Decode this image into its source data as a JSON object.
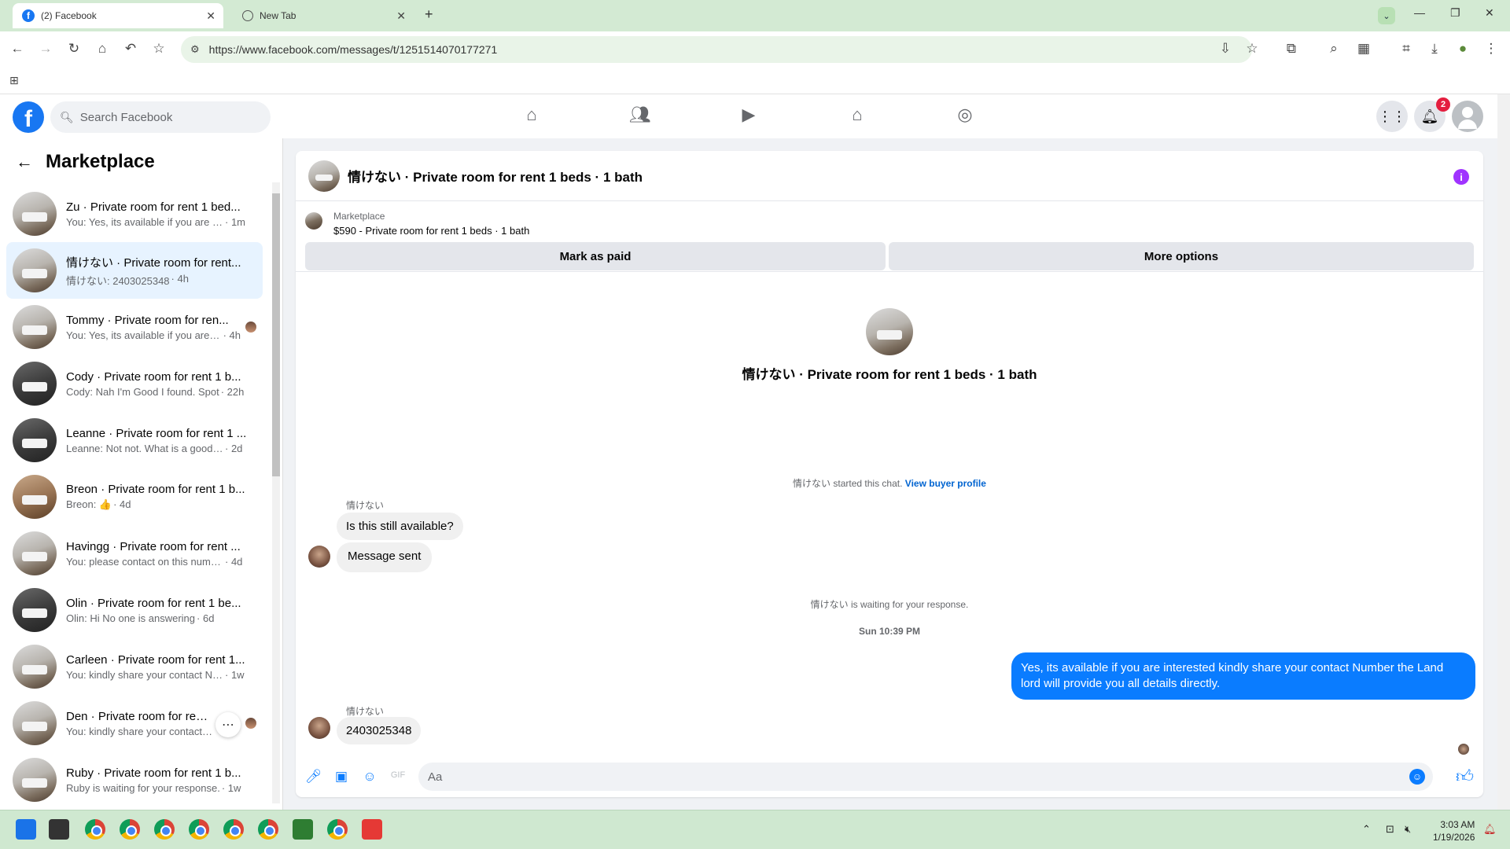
{
  "browser": {
    "tabs": [
      {
        "label": "(2) Facebook",
        "active": true
      },
      {
        "label": "New Tab",
        "active": false
      }
    ],
    "url": "https://www.facebook.com/messages/t/1251514070177271"
  },
  "fb": {
    "search_placeholder": "Search Facebook",
    "notification_count": "2"
  },
  "sidebar": {
    "title": "Marketplace",
    "conversations": [
      {
        "name": "Zu · Private room for rent 1 bed...",
        "msg": "You: Yes, its available if you are int...",
        "time": " · 1m",
        "thumb": ""
      },
      {
        "name": "情けない · Private room for rent...",
        "msg": "情けない: 2403025348",
        "time": " · 4h",
        "thumb": ""
      },
      {
        "name": "Tommy · Private room for ren...",
        "msg": "You: Yes, its available if you are i...",
        "time": " · 4h",
        "thumb": ""
      },
      {
        "name": "Cody · Private room for rent 1 b...",
        "msg": "Cody: Nah I'm Good I found. Spot",
        "time": " · 22h",
        "thumb": "dark"
      },
      {
        "name": "Leanne · Private room for rent 1 ...",
        "msg": "Leanne: Not not. What is a good ti...",
        "time": " · 2d",
        "thumb": "dark"
      },
      {
        "name": "Breon · Private room for rent 1 b...",
        "msg": "Breon: 👍",
        "time": " · 4d",
        "thumb": "warm"
      },
      {
        "name": "Havingg · Private room for rent ...",
        "msg": "You: please contact on this number...",
        "time": " · 4d",
        "thumb": ""
      },
      {
        "name": "Olin · Private room for rent 1 be...",
        "msg": "Olin: Hi No one is answering",
        "time": " · 6d",
        "thumb": "dark"
      },
      {
        "name": "Carleen · Private room for rent 1...",
        "msg": "You: kindly share your contact Nu...",
        "time": " · 1w",
        "thumb": ""
      },
      {
        "name": "Den · Private room for rent 1",
        "msg": "You: kindly share your contact ...",
        "time": "",
        "thumb": ""
      },
      {
        "name": "Ruby · Private room for rent 1 b...",
        "msg": "Ruby is waiting for your response.",
        "time": " · 1w",
        "thumb": ""
      }
    ]
  },
  "chat": {
    "header_title": "情けない · Private room for rent 1 beds · 1 bath",
    "marketplace_label": "Marketplace",
    "listing": "$590 - Private room for rent 1 beds · 1 bath",
    "mark_paid": "Mark as paid",
    "more_options": "More options",
    "hero_title": "情けない · Private room for rent 1 beds · 1 bath",
    "started_text": "情けない started this chat.",
    "view_profile": "View buyer profile",
    "sender_name": "情けない",
    "msg1": "Is this still available?",
    "msg2": "Message sent",
    "waiting": "情けない is waiting for your response.",
    "timestamp": "Sun 10:39 PM",
    "out_msg": "Yes, its available if you are interested kindly share your contact Number the Land lord will provide you all details directly.",
    "sender_name2": "情けない",
    "msg3": "2403025348",
    "composer_placeholder": "Aa"
  },
  "system": {
    "time": "3:03 AM",
    "date": "1/19/2026"
  }
}
